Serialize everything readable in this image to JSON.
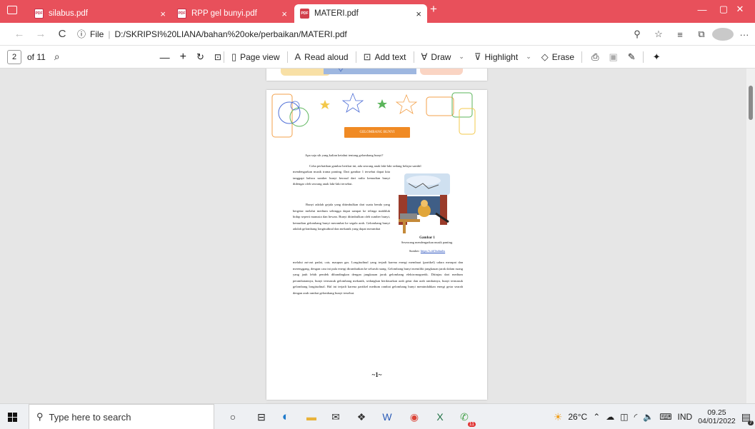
{
  "tabs": [
    {
      "title": "silabus.pdf",
      "close": "×"
    },
    {
      "title": "RPP gel bunyi.pdf",
      "close": "×"
    },
    {
      "title": "MATERI.pdf",
      "close": "×",
      "active": true
    }
  ],
  "new_tab_label": "+",
  "window_controls": {
    "minimize": "—",
    "restore": "▢",
    "close": "✕"
  },
  "address": {
    "back": "←",
    "forward": "→",
    "refresh": "C",
    "info_icon": "ⓘ",
    "scheme_label": "File",
    "url": "D:/SKRIPSI%20LIANA/bahan%20oke/perbaikan/MATERI.pdf"
  },
  "pdf_toolbar": {
    "page_current": "2",
    "page_total": "of 11",
    "zoom_out": "—",
    "zoom_in": "+",
    "page_view": "Page view",
    "read_aloud": "Read aloud",
    "add_text": "Add text",
    "draw": "Draw",
    "highlight": "Highlight",
    "erase": "Erase"
  },
  "document": {
    "banner": "GELOMBANG BUNYI",
    "question": "Apa saja sih yang kalian ketahui tentang gelombang bunyi?",
    "para1_line1": "Coba perhatikan gambar berikut ini, ada seorang anak laki-laki sedang belajar sambil",
    "para1_rest": "mendengarkan musik irama panting. Dari gambar 1 tersebut dapat kita tanggapi bahwa sumber bunyi berasal dari radio kemudian bunyi didengar oleh seorang anak laki-laki tersebut.",
    "para2_narrow": "Bunyi adalah gejala yang ditimbulkan dari suatu benda yang bergetar melalui medium sehingga dapat sampai ke telinga makhluk hidup seperti manusia dan hewan. Bunyi ditimbulkan oleh sumber bunyi, kemudian gelombang bunyi merambat ke segala arah. Gelombang bunyi adalah gelombang longitudinal dan mekanik yang dapat merambat",
    "para2_wide": "melalui zat-zat padat, cair, maupun gas. Longitudinal yang terjadi karena energi membuat (partikel) udara merapat dan merenggang, dengan cara ini pula energi dirambatkan ke seluruh ruang. Gelombang bunyi memiliki jangkauan jarak dalam ruang yang jauh lebih pendek dibandingkan dengan jangkauan jarak gelombang elektromagnetik. Ditinjau dari medium perambatannya, bunyi termasuk gelombang mekanik, sedangkan berdasarkan arah getar dan arah rambatnya, bunyi termasuk gelombang longitudinal. Hal ini terjadi karena partikel medium rambat gelombang bunyi memindahkan energi getar searah dengan arah rambat gelombang bunyi tersebut.",
    "caption_title": "Gambar 1",
    "caption_text": "Seseorang mendengarkan musik panting.",
    "caption_source_label": "Sumber:",
    "caption_source_link": "https://s.id/lisduuhs",
    "page_number": "~1~"
  },
  "taskbar": {
    "search_placeholder": "Type here to search",
    "badge": "11",
    "temperature": "26°C",
    "language": "IND",
    "time": "09.25",
    "date": "04/01/2022",
    "notification_badge": "7"
  },
  "colors": {
    "tabbar": "#e8505b",
    "banner": "#f08a24",
    "page_bg": "#ffffff",
    "viewer_bg": "#e6e6e6"
  }
}
